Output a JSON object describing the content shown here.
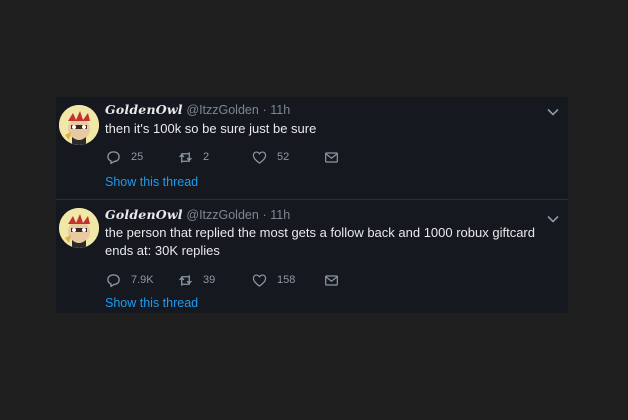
{
  "tweets": [
    {
      "display_name": "GoldenOwl",
      "handle": "@ItzzGolden",
      "separator": "·",
      "time": "11h",
      "text": "then it's 100k so be sure just be sure",
      "replies": "25",
      "retweets": "2",
      "likes": "52",
      "show_thread": "Show this thread"
    },
    {
      "display_name": "GoldenOwl",
      "handle": "@ItzzGolden",
      "separator": "·",
      "time": "11h",
      "text": "the person that replied the most gets a follow back and 1000 robux giftcard ends at: 30K replies",
      "replies": "7.9K",
      "retweets": "39",
      "likes": "158",
      "show_thread": "Show this thread"
    }
  ],
  "colors": {
    "background": "#1f1f1f",
    "card": "#15181f",
    "text": "#e7e9ea",
    "muted": "#7d8791",
    "link": "#1d9bf0"
  },
  "icons": [
    "reply-icon",
    "retweet-icon",
    "like-icon",
    "message-icon",
    "chevron-down-icon"
  ]
}
